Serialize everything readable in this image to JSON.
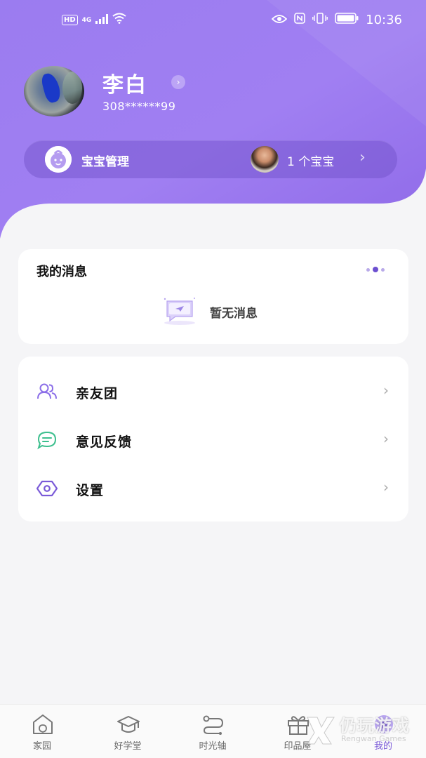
{
  "status_bar": {
    "hd": "HD",
    "network": "4G",
    "time": "10:36"
  },
  "profile": {
    "name": "李白",
    "phone": "308******99"
  },
  "baby_bar": {
    "label": "宝宝管理",
    "count": "1 个宝宝"
  },
  "messages": {
    "title": "我的消息",
    "empty_text": "暂无消息"
  },
  "menu": [
    {
      "label": "亲友团",
      "icon": "people-icon"
    },
    {
      "label": "意见反馈",
      "icon": "feedback-icon"
    },
    {
      "label": "设置",
      "icon": "settings-icon"
    }
  ],
  "tabs": [
    {
      "label": "家园",
      "icon": "home-icon"
    },
    {
      "label": "好学堂",
      "icon": "graduation-cap-icon"
    },
    {
      "label": "时光轴",
      "icon": "timeline-icon"
    },
    {
      "label": "印品屋",
      "icon": "gift-icon"
    },
    {
      "label": "我的",
      "icon": "profile-icon",
      "active": true
    }
  ],
  "watermark": {
    "text": "仍玩游戏",
    "sub": "Rengwan Games"
  },
  "colors": {
    "accent": "#8b6ee8",
    "header_start": "#9a7cf0",
    "header_end": "#7a5ad8",
    "feedback_green": "#3dbf8e"
  }
}
